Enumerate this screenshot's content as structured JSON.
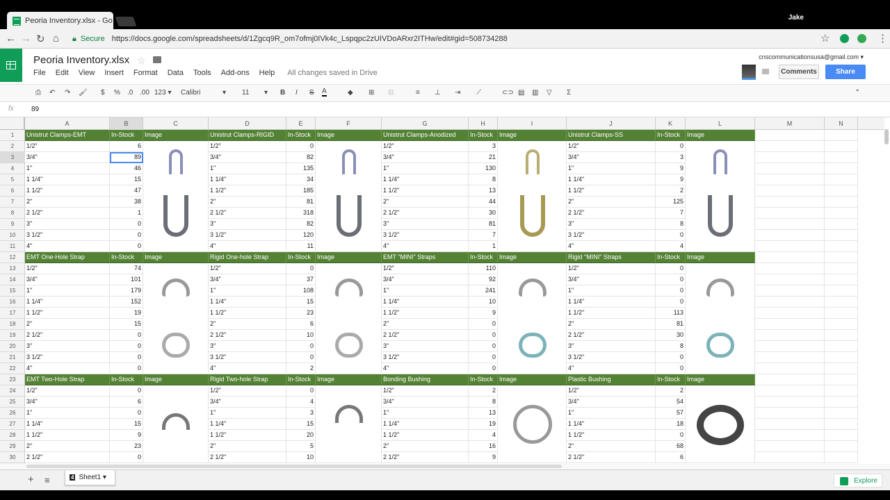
{
  "browser": {
    "tab_title": "Peoria Inventory.xlsx - Go",
    "tab_close": "×",
    "user": "Jake",
    "secure_label": "Secure",
    "url": "https://docs.google.com/spreadsheets/d/1Zgcq9R_om7ofmj0IVk4c_Lspqpc2zUIVDoARxr2ITHw/edit#gid=508734288",
    "back": "←",
    "forward": "→",
    "reload": "↻",
    "home": "⌂",
    "star": "☆",
    "menu": "⋮"
  },
  "app": {
    "title": "Peoria Inventory.xlsx",
    "star": "☆",
    "menu": [
      "File",
      "Edit",
      "View",
      "Insert",
      "Format",
      "Data",
      "Tools",
      "Add-ons",
      "Help"
    ],
    "saved_status": "All changes saved in Drive",
    "account_email": "cnscommunicationsusa@gmail.com ▾",
    "comments_label": "Comments",
    "share_label": "Share"
  },
  "toolbar": {
    "print": "⎙",
    "undo": "↶",
    "redo": "↷",
    "paint_format": "🖌",
    "currency": "$",
    "percent": "%",
    "dec_decrease": ".0",
    "dec_increase": ".00",
    "more_formats": "123 ▾",
    "font": "Calibri",
    "font_size": "11",
    "bold": "B",
    "italic": "I",
    "strike": "S",
    "text_color": "A",
    "collapse": "⌃"
  },
  "formula_bar": {
    "fx": "fx",
    "value": "89"
  },
  "columns": [
    "A",
    "B",
    "C",
    "D",
    "E",
    "F",
    "G",
    "H",
    "I",
    "J",
    "K",
    "L",
    "M",
    "N"
  ],
  "rows": [
    "1",
    "2",
    "3",
    "4",
    "5",
    "6",
    "7",
    "8",
    "9",
    "10",
    "11",
    "12",
    "13",
    "14",
    "15",
    "16",
    "17",
    "18",
    "19",
    "20",
    "21",
    "22",
    "23",
    "24",
    "25",
    "26",
    "27",
    "28",
    "29",
    "30"
  ],
  "sizes": [
    "1/2\"",
    "3/4\"",
    "1\"",
    "1 1/4\"",
    "1 1/2\"",
    "2\"",
    "2 1/2\"",
    "3\"",
    "3 1/2\"",
    "4\""
  ],
  "in_stock_label": "In-Stock",
  "image_label": "Image",
  "blocks": [
    {
      "title": "Unistrut Clamps-EMT",
      "values": [
        "6",
        "89",
        "46",
        "15",
        "47",
        "38",
        "1",
        "0",
        "0",
        "0"
      ]
    },
    {
      "title": "Unistrut Clamps-RIGID",
      "values": [
        "0",
        "82",
        "135",
        "34",
        "185",
        "81",
        "318",
        "82",
        "120",
        "11"
      ]
    },
    {
      "title": "Unistrut Clamps-Anodized",
      "values": [
        "3",
        "21",
        "130",
        "8",
        "13",
        "44",
        "30",
        "81",
        "7",
        "1"
      ]
    },
    {
      "title": "Unistrut Clamps-SS",
      "values": [
        "0",
        "3",
        "9",
        "9",
        "2",
        "125",
        "7",
        "8",
        "0",
        "4"
      ]
    },
    {
      "title": "EMT One-Hole Strap",
      "values": [
        "74",
        "101",
        "179",
        "152",
        "19",
        "15",
        "0",
        "0",
        "0",
        "0"
      ]
    },
    {
      "title": "Rigid One-hole Strap",
      "values": [
        "0",
        "37",
        "108",
        "15",
        "23",
        "6",
        "10",
        "0",
        "0",
        "2"
      ]
    },
    {
      "title": "EMT \"MINI\" Straps",
      "values": [
        "110",
        "92",
        "241",
        "10",
        "9",
        "0",
        "0",
        "0",
        "0",
        "0"
      ]
    },
    {
      "title": "Rigid \"MINI\" Straps",
      "values": [
        "0",
        "0",
        "0",
        "0",
        "113",
        "81",
        "30",
        "8",
        "0",
        "0"
      ]
    },
    {
      "title": "EMT Two-Hole Strap",
      "values": [
        "0",
        "6",
        "0",
        "15",
        "9",
        "23",
        "0"
      ]
    },
    {
      "title": "Rigid Two-hole Strap",
      "values": [
        "0",
        "4",
        "3",
        "15",
        "20",
        "5",
        "10"
      ]
    },
    {
      "title": "Bonding Bushing",
      "values": [
        "2",
        "8",
        "13",
        "19",
        "4",
        "16",
        "9"
      ]
    },
    {
      "title": "Plastic Bushing",
      "values": [
        "2",
        "54",
        "57",
        "18",
        "0",
        "68",
        "6"
      ]
    }
  ],
  "sheet_tab": {
    "badge": "4",
    "name": "Sheet1 ▾"
  },
  "bottom": {
    "add": "+",
    "list": "≡",
    "explore": "Explore"
  }
}
